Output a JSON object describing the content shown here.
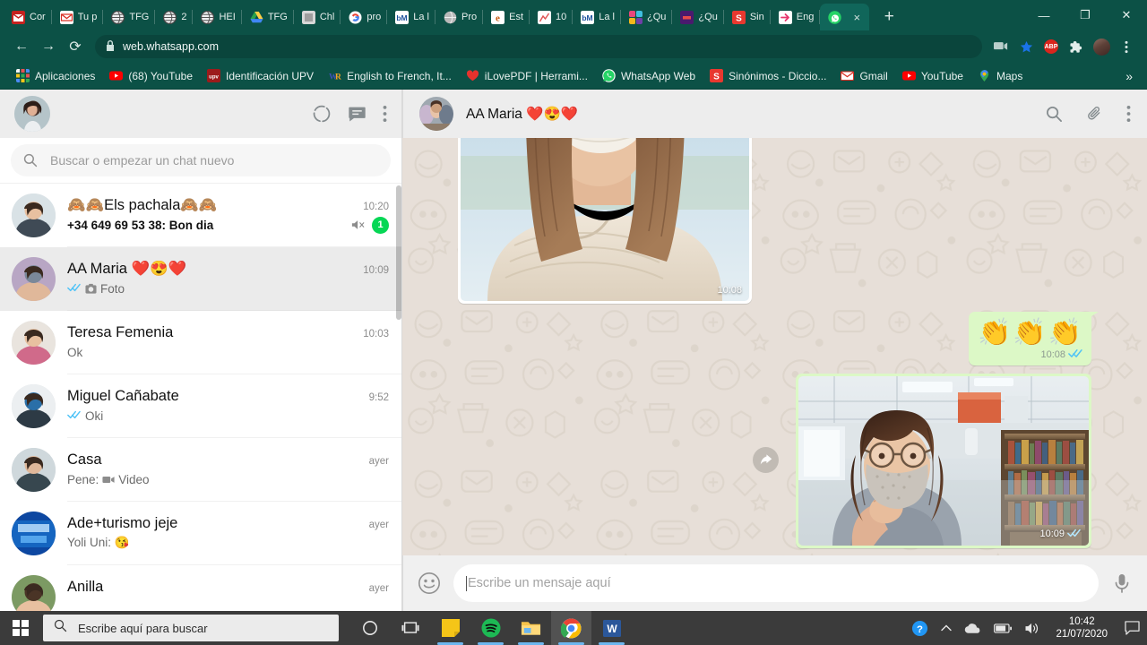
{
  "browser": {
    "tabs": [
      {
        "title": "Cor",
        "favicon": "gmail-red",
        "active": false
      },
      {
        "title": "Tu p",
        "favicon": "gmail-envelope",
        "active": false
      },
      {
        "title": "TFG",
        "favicon": "globe-dark",
        "active": false
      },
      {
        "title": "2",
        "favicon": "globe-dark",
        "active": false
      },
      {
        "title": "HEI",
        "favicon": "globe-dark",
        "active": false
      },
      {
        "title": "TFG",
        "favicon": "google-drive",
        "active": false
      },
      {
        "title": "Chl",
        "favicon": "grey-page",
        "active": false
      },
      {
        "title": "pro",
        "favicon": "google-g",
        "active": false
      },
      {
        "title": "La l",
        "favicon": "bm-blue",
        "active": false
      },
      {
        "title": "Pro",
        "favicon": "grey-globe",
        "active": false
      },
      {
        "title": "Est",
        "favicon": "e-orange",
        "active": false
      },
      {
        "title": "10 ",
        "favicon": "chart-white",
        "active": false
      },
      {
        "title": "La l",
        "favicon": "bm-blue",
        "active": false
      },
      {
        "title": "¿Qu",
        "favicon": "colorful-squares",
        "active": false
      },
      {
        "title": "¿Qu",
        "favicon": "purple-box",
        "active": false
      },
      {
        "title": "Sin",
        "favicon": "s-red",
        "active": false
      },
      {
        "title": "Eng",
        "favicon": "pink-arrow",
        "active": false
      },
      {
        "title": "",
        "favicon": "whatsapp-green",
        "active": true
      }
    ],
    "newtab_label": "+",
    "close_label": "×",
    "window_minimize": "—",
    "window_restore": "❐",
    "window_close": "✕",
    "nav": {
      "back": "←",
      "forward": "→",
      "reload": "⟳",
      "lock_icon": "lock-icon",
      "url": "web.whatsapp.com"
    },
    "toolbar_icons": [
      "cast-icon",
      "bookmark-star-icon",
      "adblock-icon",
      "extensions-icon",
      "profile-avatar-icon",
      "chrome-menu-icon"
    ],
    "adblock_label": "ABP",
    "bookmarks": [
      {
        "label": "Aplicaciones",
        "icon": "apps-grid-icon"
      },
      {
        "label": "(68) YouTube",
        "icon": "youtube-icon"
      },
      {
        "label": "Identificación UPV",
        "icon": "upv-icon"
      },
      {
        "label": "English to French, It...",
        "icon": "wordreference-icon"
      },
      {
        "label": "iLovePDF | Herrami...",
        "icon": "ilovepdf-icon"
      },
      {
        "label": "WhatsApp Web",
        "icon": "whatsapp-icon"
      },
      {
        "label": "Sinónimos - Diccio...",
        "icon": "sinonimos-icon"
      },
      {
        "label": "Gmail",
        "icon": "gmail-icon"
      },
      {
        "label": "YouTube",
        "icon": "youtube-icon"
      },
      {
        "label": "Maps",
        "icon": "maps-icon"
      }
    ],
    "bookmarks_overflow": "»"
  },
  "whatsapp": {
    "left_panel": {
      "profile_avatar": "user-avatar",
      "header_icons": [
        "status-circle-icon",
        "new-chat-icon",
        "menu-dots-icon"
      ],
      "search": {
        "placeholder": "Buscar o empezar un chat nuevo",
        "icon": "search-icon"
      },
      "chats": [
        {
          "name": "🙈🙈Els pachala🙈🙈",
          "message": "+34 649 69 53 38: Bon dia",
          "time": "10:20",
          "unread_count": "1",
          "muted": true,
          "bold": true,
          "active": false,
          "ticks": false,
          "media_icon": ""
        },
        {
          "name": "AA Maria ❤️😍❤️",
          "message": "Foto",
          "time": "10:09",
          "unread_count": "",
          "muted": false,
          "bold": false,
          "active": true,
          "ticks": true,
          "media_icon": "photo-icon"
        },
        {
          "name": "Teresa Femenia",
          "message": "Ok",
          "time": "10:03",
          "unread_count": "",
          "muted": false,
          "bold": false,
          "active": false,
          "ticks": false,
          "media_icon": ""
        },
        {
          "name": "Miguel Cañabate",
          "message": "Oki",
          "time": "9:52",
          "unread_count": "",
          "muted": false,
          "bold": false,
          "active": false,
          "ticks": true,
          "media_icon": ""
        },
        {
          "name": "Casa",
          "message": "Pene: Video",
          "time": "ayer",
          "unread_count": "",
          "muted": false,
          "bold": false,
          "active": false,
          "ticks": false,
          "media_icon": "video-icon"
        },
        {
          "name": "Ade+turismo jeje",
          "message": "Yoli Uni: 😘",
          "time": "ayer",
          "unread_count": "",
          "muted": false,
          "bold": false,
          "active": false,
          "ticks": false,
          "media_icon": ""
        },
        {
          "name": "Anilla",
          "message": "",
          "time": "ayer",
          "unread_count": "",
          "muted": false,
          "bold": false,
          "active": false,
          "ticks": false,
          "media_icon": ""
        }
      ]
    },
    "conversation": {
      "contact_name": "AA Maria ❤️😍❤️",
      "contact_avatar": "contact-avatar",
      "header_icons": [
        "search-icon",
        "attach-clip-icon",
        "menu-dots-icon"
      ],
      "messages": [
        {
          "type": "image",
          "direction": "in",
          "time": "10:08",
          "ticks": false,
          "forward": true,
          "alt": "photo of person wearing mask"
        },
        {
          "type": "text",
          "direction": "out",
          "text": "👏👏👏",
          "time": "10:08",
          "ticks": true,
          "forward": false
        },
        {
          "type": "image",
          "direction": "out",
          "time": "10:09",
          "ticks": true,
          "forward": true,
          "alt": "selfie in library with mask"
        }
      ],
      "composer": {
        "emoji_icon": "emoji-smiley-icon",
        "placeholder": "Escribe un mensaje aquí",
        "mic_icon": "microphone-icon"
      }
    }
  },
  "taskbar": {
    "start_icon": "windows-start-icon",
    "search_placeholder": "Escribe aquí para buscar",
    "search_icon": "search-icon",
    "icons": [
      {
        "name": "cortana-circle-icon",
        "open": false,
        "active": false
      },
      {
        "name": "task-view-icon",
        "open": false,
        "active": false
      },
      {
        "name": "sticky-notes-icon",
        "open": true,
        "active": false
      },
      {
        "name": "spotify-icon",
        "open": true,
        "active": false
      },
      {
        "name": "file-explorer-icon",
        "open": true,
        "active": false
      },
      {
        "name": "chrome-icon",
        "open": true,
        "active": true
      },
      {
        "name": "word-icon",
        "open": true,
        "active": false
      }
    ],
    "tray": [
      {
        "name": "help-question-icon"
      },
      {
        "name": "show-hidden-icons-chevron"
      },
      {
        "name": "onedrive-cloud-icon"
      },
      {
        "name": "battery-icon"
      },
      {
        "name": "volume-icon"
      }
    ],
    "time": "10:42",
    "date": "21/07/2020",
    "notification_icon": "action-center-icon"
  },
  "colors": {
    "chrome_theme": "#0c5146",
    "whatsapp_green": "#00bfa5",
    "outgoing_bubble": "#dcf8c6",
    "chat_bg": "#e7dfd8",
    "unread_badge": "#06d755",
    "tick_blue": "#4fc3f7",
    "taskbar": "#3b3b3b"
  }
}
